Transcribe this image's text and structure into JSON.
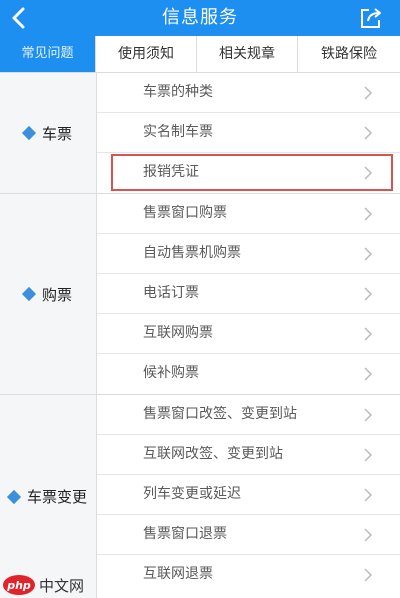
{
  "header": {
    "title": "信息服务",
    "back_icon": "chevron-left-icon",
    "share_icon": "share-icon"
  },
  "tabs": [
    {
      "label": "常见问题",
      "active": true
    },
    {
      "label": "使用须知",
      "active": false
    },
    {
      "label": "相关规章",
      "active": false
    },
    {
      "label": "铁路保险",
      "active": false
    }
  ],
  "groups": [
    {
      "category": "车票",
      "items": [
        "车票的种类",
        "实名制车票",
        "报销凭证"
      ]
    },
    {
      "category": "购票",
      "items": [
        "售票窗口购票",
        "自动售票机购票",
        "电话订票",
        "互联网购票",
        "候补购票"
      ]
    },
    {
      "category": "车票变更",
      "items": [
        "售票窗口改签、变更到站",
        "互联网改签、变更到站",
        "列车变更或延迟",
        "售票窗口退票",
        "互联网退票"
      ]
    }
  ],
  "highlighted_item": "报销凭证",
  "watermark": {
    "logo": "php",
    "text": "中文网"
  },
  "colors": {
    "accent": "#1c8ff0",
    "highlight": "#d9534f",
    "diamond": "#3b8fdc"
  }
}
